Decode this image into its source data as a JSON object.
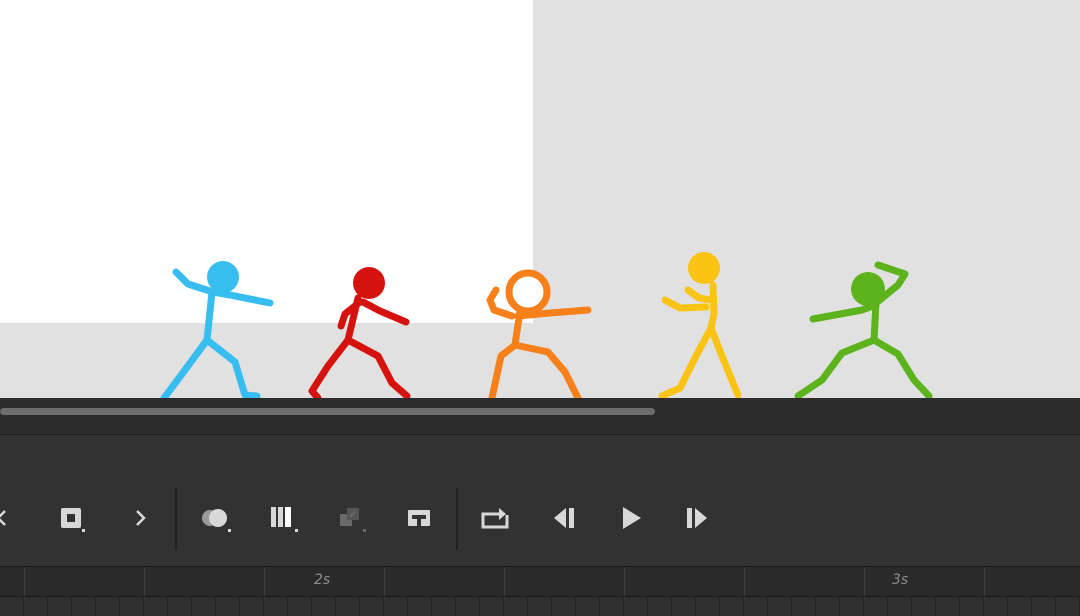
{
  "stage": {
    "canvas_color": "#ffffff",
    "pasteboard_color": "#e1e1e1",
    "figures": [
      {
        "name": "blue-stick-figure",
        "color": "#38bdf0"
      },
      {
        "name": "red-stick-figure",
        "color": "#d5120e"
      },
      {
        "name": "orange-stick-figure",
        "color": "#f7801a"
      },
      {
        "name": "yellow-stick-figure",
        "color": "#fbc313"
      },
      {
        "name": "green-stick-figure",
        "color": "#5cb31c"
      }
    ]
  },
  "toolbar": {
    "buttons": [
      {
        "id": "prev-keyframe",
        "icon": "chevron-left-icon"
      },
      {
        "id": "insert-keyframe",
        "icon": "keyframe-box-icon"
      },
      {
        "id": "next-keyframe",
        "icon": "chevron-right-icon"
      },
      {
        "id": "onion-skin",
        "icon": "onion-skin-icon"
      },
      {
        "id": "edit-multiple-frames",
        "icon": "multi-frame-icon"
      },
      {
        "id": "paste-frames",
        "icon": "layers-paste-icon"
      },
      {
        "id": "center-frame",
        "icon": "center-frame-icon"
      },
      {
        "id": "loop",
        "icon": "loop-icon"
      },
      {
        "id": "step-back",
        "icon": "step-back-icon"
      },
      {
        "id": "play",
        "icon": "play-icon"
      },
      {
        "id": "step-forward",
        "icon": "step-forward-icon"
      }
    ]
  },
  "timeline": {
    "ticks": [
      "2s",
      "3s"
    ]
  },
  "colors": {
    "panel": "#323232",
    "icon": "#d8d8d8",
    "icon_disabled": "#6a6a6a"
  }
}
